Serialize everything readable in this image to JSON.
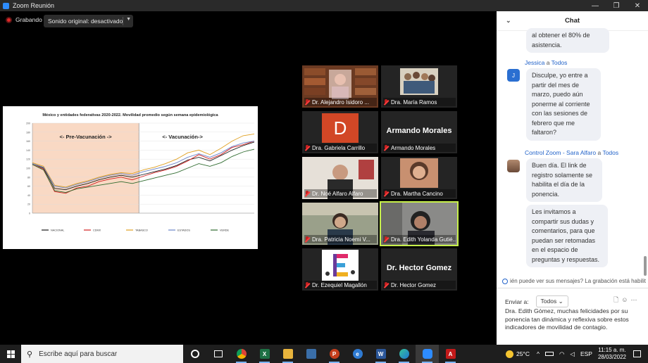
{
  "window": {
    "title": "Zoom Reunión",
    "controls": [
      "—",
      "❐",
      "✕"
    ]
  },
  "toolbar": {
    "recording_label": "Grabando",
    "sound_button_label": "Sonido original: desactivado"
  },
  "shared_screen": {
    "chart_data": {
      "type": "line",
      "title": "México y entidades federativas 2020-2022. Movilidad promedio según semana epidemiológica",
      "regions": [
        {
          "label": "<- Pre-Vacunación ->",
          "color": "#f9d9c4"
        },
        {
          "label": "<- Vacunación->",
          "color": "#ffffff"
        }
      ],
      "ylim": [
        0,
        200
      ],
      "y_ticks": [
        0,
        10,
        20,
        30,
        40,
        50,
        60,
        70,
        80,
        90,
        100,
        110,
        120,
        130,
        140,
        150,
        160,
        170,
        180,
        190,
        200
      ],
      "grid": true,
      "legend_position": "bottom",
      "series": [
        {
          "name": "NACIONAL",
          "color": "#1a1a1a",
          "values": [
            110,
            100,
            55,
            52,
            60,
            66,
            74,
            80,
            84,
            80,
            86,
            92,
            98,
            106,
            118,
            124,
            116,
            128,
            140,
            150,
            158
          ]
        },
        {
          "name": "CDMX",
          "color": "#d12020",
          "values": [
            108,
            98,
            48,
            44,
            56,
            60,
            70,
            76,
            80,
            74,
            82,
            90,
            96,
            104,
            116,
            130,
            120,
            130,
            146,
            152,
            160
          ]
        },
        {
          "name": "TABASCO",
          "color": "#e0a020",
          "values": [
            112,
            104,
            62,
            58,
            66,
            72,
            80,
            86,
            90,
            88,
            96,
            102,
            110,
            120,
            134,
            140,
            130,
            144,
            160,
            172,
            176
          ]
        },
        {
          "name": "ESTADOS",
          "color": "#6b85c9",
          "values": [
            110,
            102,
            60,
            56,
            64,
            70,
            78,
            84,
            88,
            84,
            92,
            98,
            104,
            112,
            124,
            132,
            124,
            134,
            148,
            156,
            160
          ]
        },
        {
          "name": "VERDE",
          "color": "#2f6b2f",
          "values": [
            108,
            96,
            50,
            46,
            54,
            58,
            62,
            66,
            70,
            66,
            72,
            78,
            84,
            90,
            100,
            110,
            104,
            112,
            126,
            136,
            142
          ]
        }
      ]
    }
  },
  "participants": [
    {
      "name": "Dr. Alejandro Isidoro ...",
      "kind": "video"
    },
    {
      "name": "Dra. María Ramos",
      "kind": "photo"
    },
    {
      "name": "Dra. Gabriela Carrillo",
      "kind": "initial",
      "initial": "D"
    },
    {
      "name": "Armando Morales",
      "kind": "text",
      "display": "Armando Morales"
    },
    {
      "name": "Dr. Noé Alfaro Alfaro",
      "kind": "video"
    },
    {
      "name": "Dra. Martha Cancino",
      "kind": "photo"
    },
    {
      "name": "Dra. Patricia Noemi V...",
      "kind": "video"
    },
    {
      "name": "Dra. Edith Yolanda Gutié...",
      "kind": "video"
    },
    {
      "name": "Dr. Ezequiel Magallón",
      "kind": "logo"
    },
    {
      "name": "Dr. Hector Gomez",
      "kind": "text",
      "display": "Dr. Hector Gomez"
    }
  ],
  "chat": {
    "title": "Chat",
    "collapse_icon": "chevron-down-icon",
    "messages": [
      {
        "sender": "",
        "to": "",
        "text": "al obtener el 80% de asistencia."
      },
      {
        "sender": "Jessica",
        "to_word": "a",
        "to": "Todos",
        "avatar": "J",
        "text": "Disculpe, yo entre a partir del mes de marzo, puedo aún ponerme al corriente con las sesiones de febrero que me faltaron?"
      },
      {
        "sender": "Control Zoom - Sara Alfaro",
        "to_word": "a",
        "to": "Todos",
        "text": "Buen día. El link de registro solamente se habilita el día de la ponencia."
      },
      {
        "sender": "",
        "to": "",
        "text": "Les invitamos a compartir sus dudas y comentarios, para que puedan ser retomadas en el espacio de preguntas y respuestas."
      }
    ],
    "notice": "ién puede ver sus mensajes? La grabación está habilit",
    "send_to_label": "Enviar a:",
    "send_to_value": "Todos",
    "draft_text": "Dra. Edith Gómez, muchas felicidades por su ponencia tan dinámica y reflexiva sobre estos indicadores de movilidad de contagio."
  },
  "taskbar": {
    "search_placeholder": "Escribe aquí para buscar",
    "apps": [
      "cortana-icon",
      "task-view-icon",
      "chrome-icon",
      "excel-icon",
      "file-explorer-icon",
      "store-icon",
      "powerpoint-icon",
      "edge-legacy-icon",
      "word-icon",
      "edge-icon",
      "zoom-icon",
      "acrobat-icon"
    ],
    "weather_temp": "25°C",
    "language": "ESP",
    "time": "11:15 a. m.",
    "date": "28/03/2022"
  }
}
